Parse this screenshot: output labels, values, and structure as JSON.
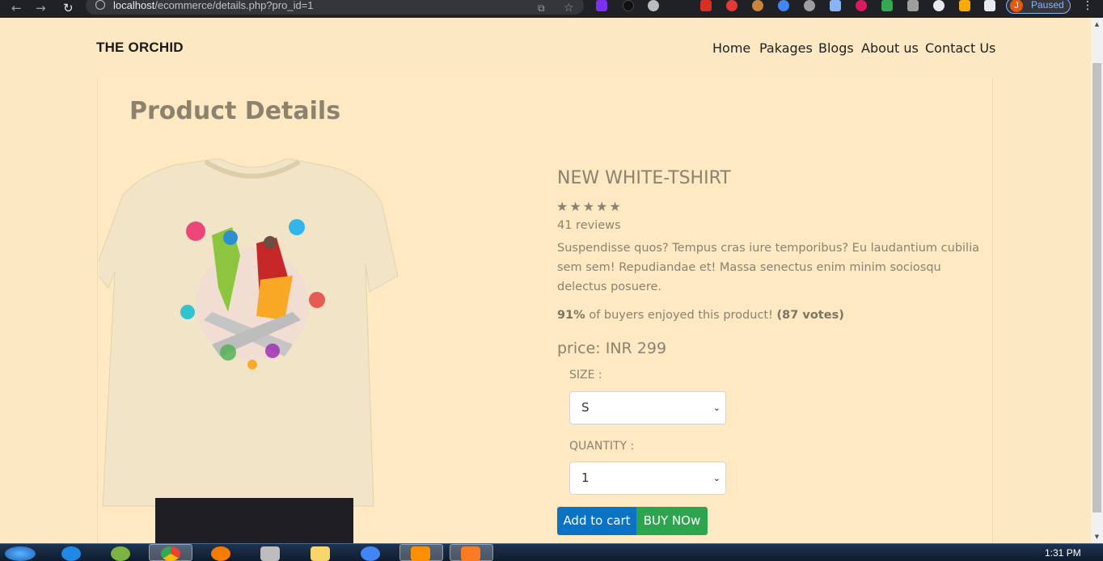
{
  "browser": {
    "url_host": "localhost",
    "url_path": "/ecommerce/details.php?pro_id=1",
    "profile_initial": "J",
    "profile_status": "Paused"
  },
  "site": {
    "brand": "THE ORCHID",
    "nav": [
      "Home",
      "Pakages",
      "Blogs",
      "About us",
      "Contact Us"
    ]
  },
  "page": {
    "title": "Product Details"
  },
  "product": {
    "name": "NEW WHITE-TSHIRT",
    "stars": "★★★★★",
    "rating_stars": 5,
    "reviews": "41 reviews",
    "description": "Suspendisse quos? Tempus cras iure temporibus? Eu laudantium cubilia sem sem! Repudiandae et! Massa senectus enim minim sociosqu delectus posuere.",
    "enjoyed_pct": "91%",
    "enjoyed_text": " of buyers enjoyed this product! ",
    "votes": "(87 votes)",
    "price": "price: INR 299",
    "size_label": "SIZE :",
    "size_value": "S",
    "quantity_label": "QUANTITY :",
    "quantity_value": "1",
    "add_to_cart": "Add to cart",
    "buy_now": "BUY NOw"
  },
  "taskbar": {
    "clock": "1:31 PM"
  },
  "colors": {
    "page_bg": "#fce8c2",
    "text_muted": "#8b826f",
    "cart_btn": "#0b72c4",
    "buy_btn": "#2ea44f"
  }
}
